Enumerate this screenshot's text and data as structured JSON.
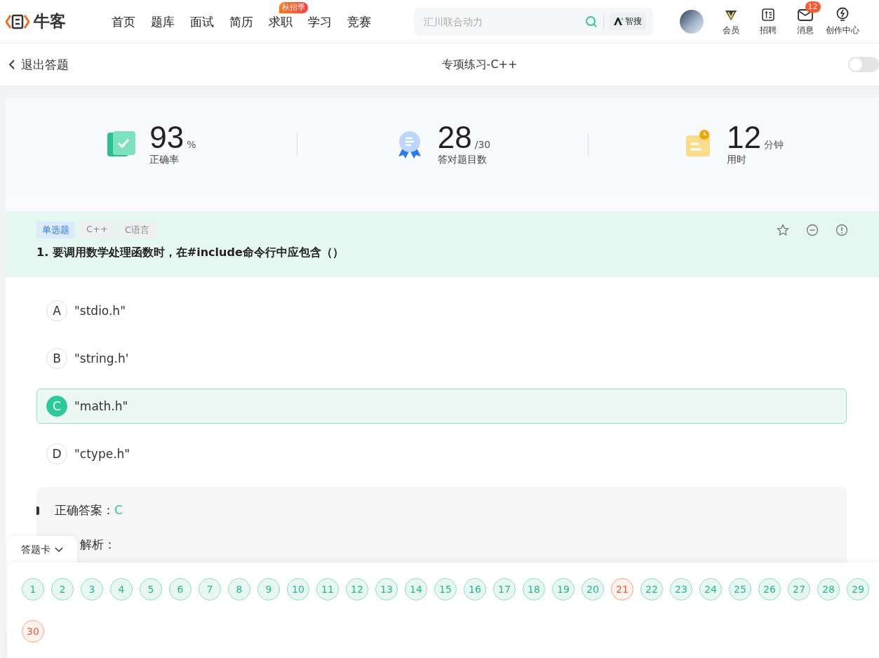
{
  "nav": {
    "logo": "牛客",
    "links": [
      {
        "label": "首页"
      },
      {
        "label": "题库"
      },
      {
        "label": "面试"
      },
      {
        "label": "简历"
      },
      {
        "label": "求职",
        "badge": "秋招季"
      },
      {
        "label": "学习"
      },
      {
        "label": "竞赛"
      }
    ],
    "search": {
      "placeholder": "汇川联合动力",
      "ai_label": "智搜"
    },
    "tools": [
      {
        "kind": "vip",
        "label": "会员"
      },
      {
        "kind": "jobs",
        "label": "招聘"
      },
      {
        "kind": "mail",
        "label": "消息",
        "badge": "12"
      },
      {
        "kind": "bulb",
        "label": "创作中心"
      }
    ]
  },
  "subbar": {
    "back": "退出答题",
    "title": "专项练习-C++",
    "toggle_on": false
  },
  "stats": [
    {
      "kind": "accuracy",
      "value": "93",
      "unit": "%",
      "label": "正确率"
    },
    {
      "kind": "count",
      "value": "28",
      "unit": "/30",
      "label": "答对题目数"
    },
    {
      "kind": "time",
      "value": "12",
      "unit": "分钟",
      "label": "用时"
    }
  ],
  "question": {
    "tags": [
      {
        "label": "单选题",
        "kind": "type"
      },
      {
        "label": "C++",
        "kind": "topic"
      },
      {
        "label": "C语言",
        "kind": "topic"
      }
    ],
    "title": "1. 要调用数学处理函数时，在#include命令行中应包含（）",
    "options": [
      {
        "letter": "A",
        "text": "\"stdio.h\"",
        "selected": false
      },
      {
        "letter": "B",
        "text": "\"string.h'",
        "selected": false
      },
      {
        "letter": "C",
        "text": "\"math.h\"",
        "selected": true
      },
      {
        "letter": "D",
        "text": "\"ctype.h\"",
        "selected": false
      }
    ]
  },
  "analysis": {
    "answer_label": "正确答案：",
    "answer": "C",
    "explain_label": "解析："
  },
  "answer_card": {
    "tab": "答题卡",
    "items": [
      {
        "number": "1",
        "correct": true
      },
      {
        "number": "2",
        "correct": true
      },
      {
        "number": "3",
        "correct": true
      },
      {
        "number": "4",
        "correct": true
      },
      {
        "number": "5",
        "correct": true
      },
      {
        "number": "6",
        "correct": true
      },
      {
        "number": "7",
        "correct": true
      },
      {
        "number": "8",
        "correct": true
      },
      {
        "number": "9",
        "correct": true
      },
      {
        "number": "10",
        "correct": true
      },
      {
        "number": "11",
        "correct": true
      },
      {
        "number": "12",
        "correct": true
      },
      {
        "number": "13",
        "correct": true
      },
      {
        "number": "14",
        "correct": true
      },
      {
        "number": "15",
        "correct": true
      },
      {
        "number": "16",
        "correct": true
      },
      {
        "number": "17",
        "correct": true
      },
      {
        "number": "18",
        "correct": true
      },
      {
        "number": "19",
        "correct": true
      },
      {
        "number": "20",
        "correct": true
      },
      {
        "number": "21",
        "correct": false
      },
      {
        "number": "22",
        "correct": true
      },
      {
        "number": "23",
        "correct": true
      },
      {
        "number": "24",
        "correct": true
      },
      {
        "number": "25",
        "correct": true
      },
      {
        "number": "26",
        "correct": true
      },
      {
        "number": "27",
        "correct": true
      },
      {
        "number": "28",
        "correct": true
      },
      {
        "number": "29",
        "correct": true
      },
      {
        "number": "30",
        "correct": false
      }
    ]
  }
}
